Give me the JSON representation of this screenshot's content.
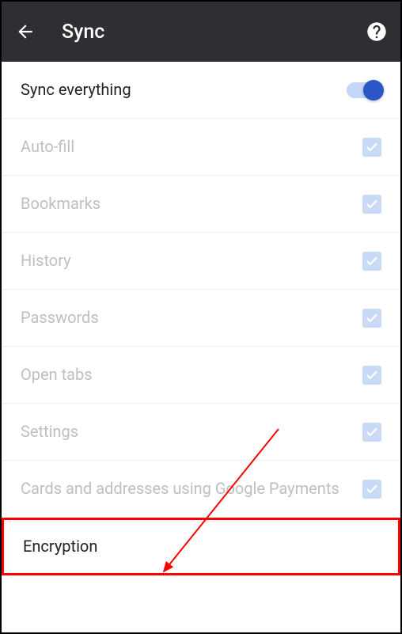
{
  "header": {
    "title": "Sync"
  },
  "master": {
    "label": "Sync everything",
    "enabled": true
  },
  "items": [
    {
      "label": "Auto-fill",
      "checked": true
    },
    {
      "label": "Bookmarks",
      "checked": true
    },
    {
      "label": "History",
      "checked": true
    },
    {
      "label": "Passwords",
      "checked": true
    },
    {
      "label": "Open tabs",
      "checked": true
    },
    {
      "label": "Settings",
      "checked": true
    },
    {
      "label": "Cards and addresses using Google Payments",
      "checked": true
    }
  ],
  "encryption": {
    "label": "Encryption"
  },
  "annotation": {
    "highlight_target": "encryption-row",
    "arrow_color": "#ff0000"
  }
}
